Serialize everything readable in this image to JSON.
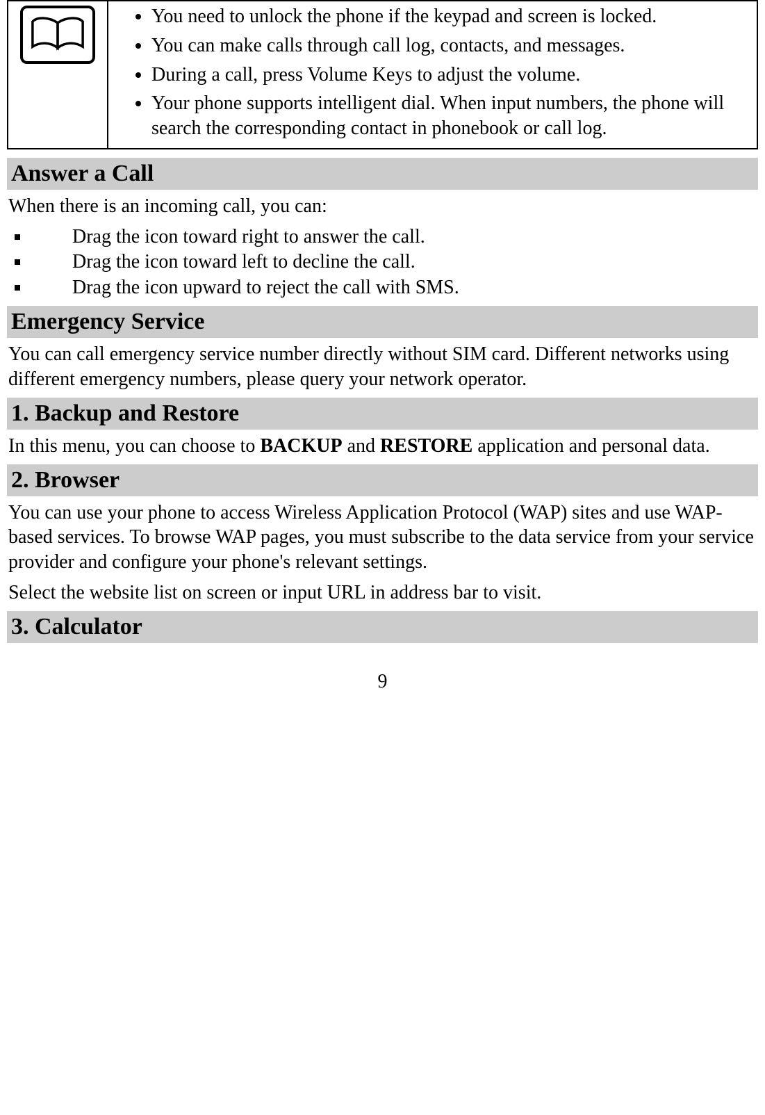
{
  "table": {
    "bullets": [
      "You need to unlock the phone if the keypad and screen is locked.",
      "You can make calls through call log, contacts, and messages.",
      "During a call, press Volume Keys to adjust the volume.",
      "Your phone supports intelligent dial. When input numbers, the phone will search the corresponding contact in phonebook or call log."
    ]
  },
  "sections": {
    "answer": {
      "title": "Answer a Call",
      "intro": "When there is an incoming call, you can:",
      "bullets": [
        "Drag the icon toward right to answer the call.",
        "Drag the icon toward left to decline the call.",
        "Drag the icon upward to reject the call with SMS."
      ]
    },
    "emergency": {
      "title": "Emergency Service",
      "body": "You can call emergency service number directly without SIM card. Different networks using different emergency numbers, please query your network operator."
    },
    "backup": {
      "title": "1. Backup and Restore",
      "body_pre": "In this menu, you can choose to ",
      "bold1": "BACKUP",
      "mid": " and ",
      "bold2": "RESTORE",
      "body_post": " application and personal data."
    },
    "browser": {
      "title": "2. Browser",
      "body1": "You can use your phone to access Wireless Application Protocol (WAP) sites and use WAP-based services. To browse WAP pages, you must subscribe to the data service from your service provider and configure your phone's relevant settings.",
      "body2": "Select the website list on screen or input URL in address bar to visit."
    },
    "calculator": {
      "title": "3. Calculator"
    }
  },
  "page_number": "9"
}
